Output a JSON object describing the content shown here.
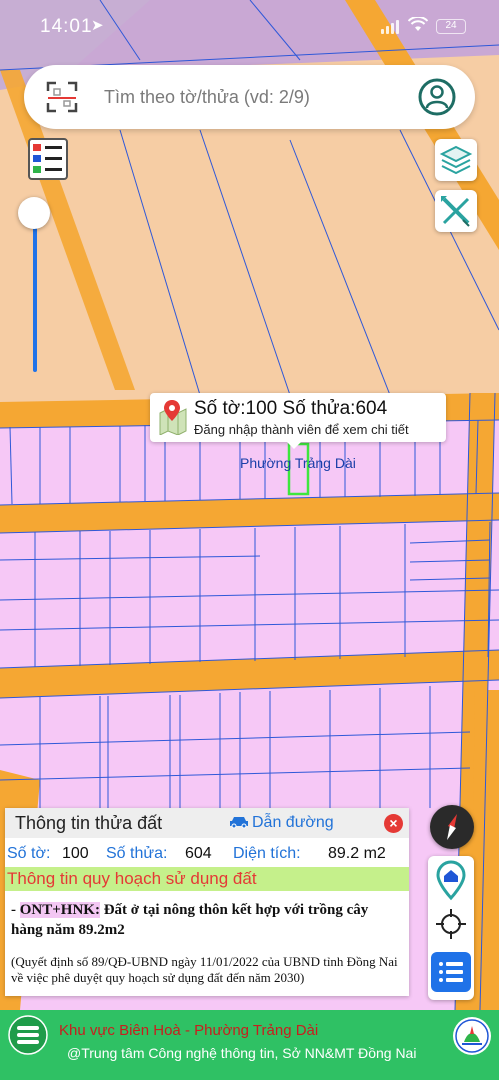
{
  "status_bar": {
    "time": "14:01",
    "battery": "24"
  },
  "search": {
    "placeholder": "Tìm theo tờ/thửa (vd: 2/9)"
  },
  "map": {
    "popup": {
      "title": "Số tờ:100 Số thửa:604",
      "subtitle": "Đăng nhập thành viên để xem chi tiết"
    },
    "ward_label": "Phường Trảng Dài",
    "zoom_level": 0.08
  },
  "info_panel": {
    "title": "Thông tin thửa đất",
    "directions_label": "Dẫn đường",
    "close_label": "×",
    "sheet_label": "Số tờ:",
    "sheet_value": "100",
    "parcel_label": "Số thửa:",
    "parcel_value": "604",
    "area_label": "Diện tích:",
    "area_value": "89.2 m2",
    "plan_header": "Thông tin quy hoạch sử dụng đất",
    "land_prefix": "- ",
    "land_code": "ONT+HNK:",
    "land_desc": " Đất ở tại nông thôn kết hợp với trồng cây hàng năm 89.2m2",
    "decision": "(Quyết định số 89/QĐ-UBND ngày 11/01/2022 của UBND tỉnh Đồng Nai về việc phê duyệt quy hoạch sử dụng đất đến năm 2030)"
  },
  "bottom_bar": {
    "area": "Khu vực Biên Hoà - Phường Trảng Dài",
    "credit": "@Trung tâm Công nghệ thông tin, Sở NN&MT Đồng Nai"
  },
  "colors": {
    "residential": "#f6c8f6",
    "road": "#f5a733",
    "background": "#f6cda4",
    "parcel_line": "#2f58d8",
    "accent_blue": "#2273d8",
    "highlight_green": "#2fc164"
  },
  "icons": [
    "qr-scan-icon",
    "user-icon",
    "legend-icon",
    "layers-icon",
    "measure-icon",
    "compass-icon",
    "home-location-icon",
    "crosshair-icon",
    "list-icon",
    "pin-icon",
    "car-icon",
    "close-icon",
    "menu-icon",
    "logo"
  ]
}
